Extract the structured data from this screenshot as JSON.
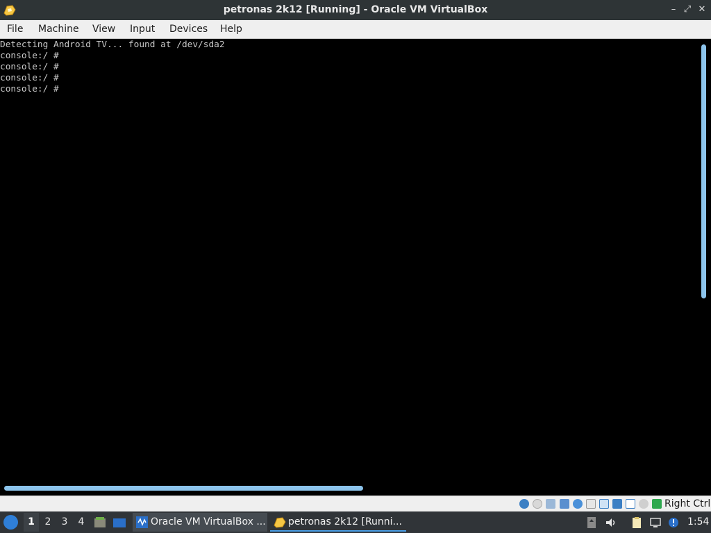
{
  "window": {
    "title": "petronas 2k12 [Running] - Oracle VM VirtualBox",
    "controls": {
      "minimize": "–",
      "restore": "⤢",
      "close": "✕"
    }
  },
  "menubar": {
    "items": [
      "File",
      "Machine",
      "View",
      "Input",
      "Devices",
      "Help"
    ]
  },
  "console": {
    "lines": [
      "Detecting Android TV... found at /dev/sda2",
      "console:/ #",
      "console:/ #",
      "console:/ #",
      "console:/ # "
    ]
  },
  "statusbar": {
    "icons": [
      "hard-disk-icon",
      "optical-drive-icon",
      "audio-icon",
      "network-icon",
      "usb-icon",
      "shared-folders-icon",
      "display-icon",
      "video-capture-icon",
      "virtualization-icon",
      "mouse-integration-icon",
      "host-key-arrow-icon"
    ],
    "host_key": "Right Ctrl"
  },
  "taskbar": {
    "desktops": [
      "1",
      "2",
      "3",
      "4"
    ],
    "active_desktop": "1",
    "tasks": [
      {
        "label": "Oracle VM VirtualBox ...",
        "icon": "virtualbox-manager-icon"
      },
      {
        "label": "petronas 2k12 [Runni...",
        "icon": "virtualbox-vm-icon"
      }
    ],
    "clock": "1:54"
  },
  "colors": {
    "titlebar_bg": "#2e3436",
    "console_bg": "#000000",
    "console_text": "#c8c8c8",
    "scrollbar": "#8cc4ec",
    "taskbar_bg": "#303438"
  }
}
